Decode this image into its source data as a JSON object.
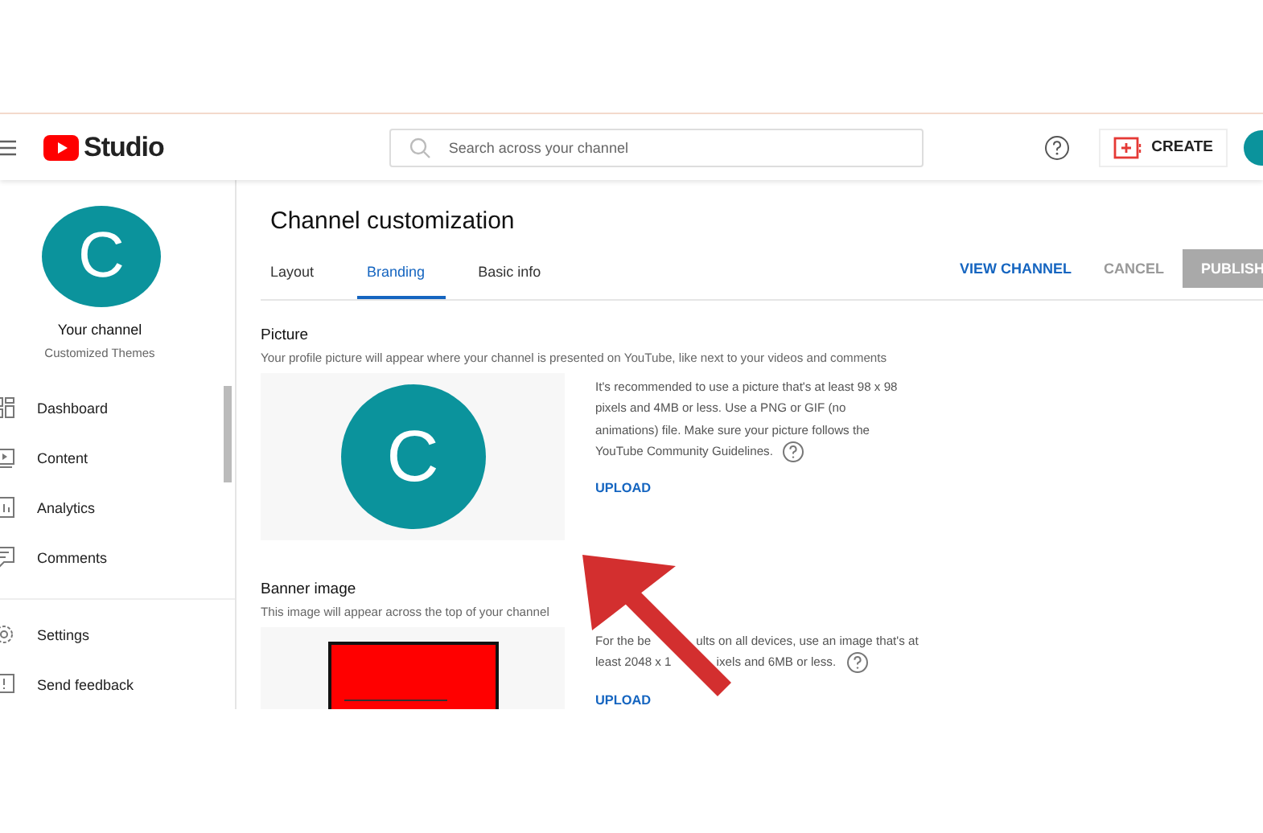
{
  "header": {
    "logo_text": "Studio",
    "search": {
      "placeholder": "Search across your channel"
    },
    "create_label": "CREATE"
  },
  "sidebar": {
    "avatar_letter": "C",
    "channel_name": "Your channel",
    "channel_subtitle": "Customized Themes",
    "items": [
      {
        "label": "Dashboard",
        "selected": false
      },
      {
        "label": "Content",
        "selected": false
      },
      {
        "label": "Analytics",
        "selected": false
      },
      {
        "label": "Comments",
        "selected": false
      }
    ],
    "footer_items": [
      {
        "label": "Settings",
        "selected": false
      },
      {
        "label": "Send feedback",
        "selected": false
      }
    ]
  },
  "main": {
    "title": "Channel customization",
    "tabs": [
      {
        "label": "Layout",
        "selected": false
      },
      {
        "label": "Branding",
        "selected": true
      },
      {
        "label": "Basic info",
        "selected": false
      }
    ],
    "actions": [
      {
        "label": "VIEW CHANNEL",
        "kind": "link",
        "disabled": false
      },
      {
        "label": "CANCEL",
        "kind": "text",
        "disabled": true
      },
      {
        "label": "PUBLISH",
        "kind": "filled",
        "disabled": true
      }
    ],
    "sections": [
      {
        "kind": "avatar",
        "heading": "Picture",
        "description": "Your profile picture will appear where your channel is presented on YouTube, like next to your videos and comments",
        "preview_letter": "C",
        "info_lines": [
          [
            "It's recommended to use a picture that's at least 98 x 98"
          ],
          [
            "pixels and 4MB or less. Use a PNG or GIF (no"
          ],
          [
            "animations) file. Make sure your picture follows the"
          ],
          [
            "YouTube Community Guidelines."
          ]
        ],
        "upload": "UPLOAD"
      },
      {
        "kind": "banner",
        "heading": "Banner image",
        "description": "This image will appear across the top of your channel",
        "info_lines": [
          [
            "For the be",
            "ults on all devices, use an image that's at"
          ],
          [
            "least 2048 x 1",
            "ixels and 6MB or less."
          ]
        ],
        "upload": "UPLOAD"
      }
    ]
  }
}
